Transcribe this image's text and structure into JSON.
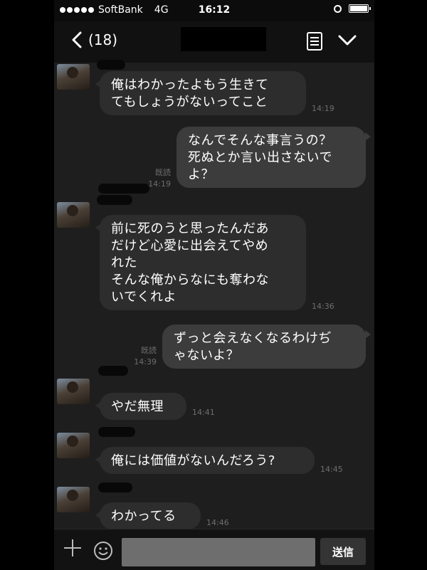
{
  "status_bar": {
    "carrier": "SoftBank",
    "network": "4G",
    "time": "16:12"
  },
  "header": {
    "unread_count": "(18)"
  },
  "read_label": "既読",
  "messages": [
    {
      "direction": "in",
      "text": "俺はわかったよもう生きて\nてもしょうがないってこと",
      "time": "14:19"
    },
    {
      "direction": "out",
      "text": "なんでそんな事言うの？\n死ぬとか言い出さないで\nよ？",
      "time": "14:19",
      "read": true
    },
    {
      "direction": "in",
      "text": "前に死のうと思ったんだあ\nだけど心愛に出会えてやめ\nれた\nそんな俺からなにも奪わな\nいでくれよ",
      "time": "14:36"
    },
    {
      "direction": "out",
      "text": "ずっと会えなくなるわけぢ\nゃないよ？",
      "time": "14:39",
      "read": true
    },
    {
      "direction": "in",
      "text": "やだ無理",
      "time": "14:41"
    },
    {
      "direction": "in",
      "text": "俺には価値がないんだろう?",
      "time": "14:45"
    },
    {
      "direction": "in",
      "text": "わかってる",
      "time": "14:46"
    }
  ],
  "input": {
    "send_label": "送信"
  },
  "colors": {
    "background": "#1e1e1e",
    "incoming_bubble": "#2d2d2d",
    "outgoing_bubble": "#3c3c3c"
  },
  "icons": [
    "back-chevron-icon",
    "list-icon",
    "chevron-down-icon",
    "plus-icon",
    "smile-icon"
  ]
}
